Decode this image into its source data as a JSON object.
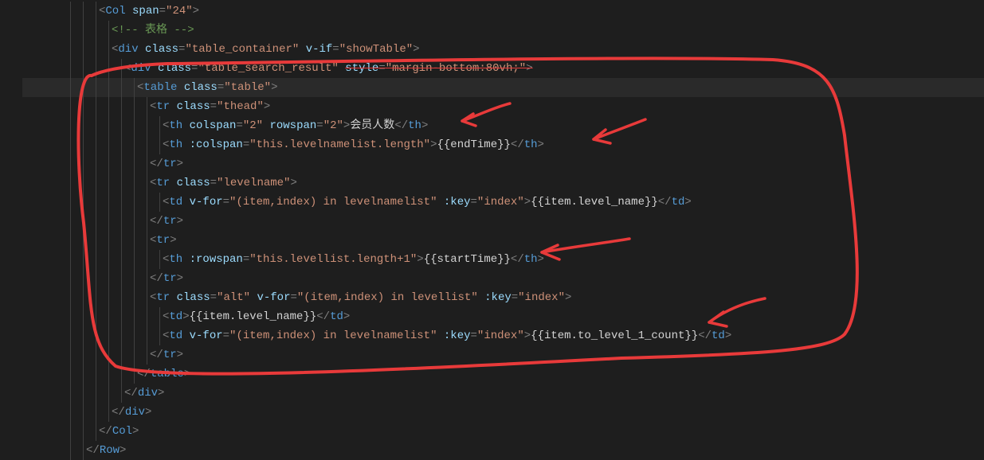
{
  "lines": {
    "l1": {
      "indent": 3,
      "tokens": [
        [
          "p-gray",
          "<"
        ],
        [
          "p-tag",
          "Col"
        ],
        [
          "p-txn",
          " "
        ],
        [
          "p-attr",
          "span"
        ],
        [
          "p-gray",
          "="
        ],
        [
          "p-str",
          "\"24\""
        ],
        [
          "p-gray",
          ">"
        ]
      ]
    },
    "l2": {
      "indent": 4,
      "tokens": [
        [
          "p-comm",
          "<!-- 表格 -->"
        ]
      ]
    },
    "l3": {
      "indent": 4,
      "tokens": [
        [
          "p-gray",
          "<"
        ],
        [
          "p-tag",
          "div"
        ],
        [
          "p-txn",
          " "
        ],
        [
          "p-attr",
          "class"
        ],
        [
          "p-gray",
          "="
        ],
        [
          "p-str",
          "\"table_container\""
        ],
        [
          "p-txn",
          " "
        ],
        [
          "p-attr",
          "v-if"
        ],
        [
          "p-gray",
          "="
        ],
        [
          "p-str",
          "\"showTable\""
        ],
        [
          "p-gray",
          ">"
        ]
      ]
    },
    "l4": {
      "indent": 5,
      "strike": true,
      "tokens": [
        [
          "p-gray",
          "<"
        ],
        [
          "p-tag",
          "div"
        ],
        [
          "p-txn",
          " "
        ],
        [
          "p-attr",
          "class"
        ],
        [
          "p-gray",
          "="
        ],
        [
          "p-str",
          "\"table_search_result\""
        ],
        [
          "p-txn",
          " "
        ],
        [
          "p-attr",
          "style"
        ],
        [
          "p-gray",
          "="
        ],
        [
          "p-str",
          "\"margin-bottom:80vh;\""
        ],
        [
          "p-gray",
          ">"
        ]
      ]
    },
    "l5": {
      "indent": 6,
      "hl": true,
      "tokens": [
        [
          "p-gray",
          "<"
        ],
        [
          "p-tag",
          "table"
        ],
        [
          "p-txn",
          " "
        ],
        [
          "p-attr",
          "class"
        ],
        [
          "p-gray",
          "="
        ],
        [
          "p-str",
          "\"table\""
        ],
        [
          "p-gray",
          ">"
        ]
      ]
    },
    "l6": {
      "indent": 7,
      "tokens": [
        [
          "p-gray",
          "<"
        ],
        [
          "p-tag",
          "tr"
        ],
        [
          "p-txn",
          " "
        ],
        [
          "p-attr",
          "class"
        ],
        [
          "p-gray",
          "="
        ],
        [
          "p-str",
          "\"thead\""
        ],
        [
          "p-gray",
          ">"
        ]
      ]
    },
    "l7": {
      "indent": 8,
      "tokens": [
        [
          "p-gray",
          "<"
        ],
        [
          "p-tag",
          "th"
        ],
        [
          "p-txn",
          " "
        ],
        [
          "p-attr",
          "colspan"
        ],
        [
          "p-gray",
          "="
        ],
        [
          "p-str",
          "\"2\""
        ],
        [
          "p-txn",
          " "
        ],
        [
          "p-attr",
          "rowspan"
        ],
        [
          "p-gray",
          "="
        ],
        [
          "p-str",
          "\"2\""
        ],
        [
          "p-gray",
          ">"
        ],
        [
          "p-txn",
          "会员人数"
        ],
        [
          "p-gray",
          "</"
        ],
        [
          "p-tag",
          "th"
        ],
        [
          "p-gray",
          ">"
        ]
      ]
    },
    "l8": {
      "indent": 8,
      "tokens": [
        [
          "p-gray",
          "<"
        ],
        [
          "p-tag",
          "th"
        ],
        [
          "p-txn",
          " "
        ],
        [
          "p-attr",
          ":colspan"
        ],
        [
          "p-gray",
          "="
        ],
        [
          "p-str",
          "\"this.levelnamelist.length\""
        ],
        [
          "p-gray",
          ">"
        ],
        [
          "p-txn",
          "{{endTime}}"
        ],
        [
          "p-gray",
          "</"
        ],
        [
          "p-tag",
          "th"
        ],
        [
          "p-gray",
          ">"
        ]
      ]
    },
    "l9": {
      "indent": 7,
      "tokens": [
        [
          "p-gray",
          "</"
        ],
        [
          "p-tag",
          "tr"
        ],
        [
          "p-gray",
          ">"
        ]
      ]
    },
    "l10": {
      "indent": 7,
      "tokens": [
        [
          "p-gray",
          "<"
        ],
        [
          "p-tag",
          "tr"
        ],
        [
          "p-txn",
          " "
        ],
        [
          "p-attr",
          "class"
        ],
        [
          "p-gray",
          "="
        ],
        [
          "p-str",
          "\"levelname\""
        ],
        [
          "p-gray",
          ">"
        ]
      ]
    },
    "l11": {
      "indent": 8,
      "tokens": [
        [
          "p-gray",
          "<"
        ],
        [
          "p-tag",
          "td"
        ],
        [
          "p-txn",
          " "
        ],
        [
          "p-attr",
          "v-for"
        ],
        [
          "p-gray",
          "="
        ],
        [
          "p-str",
          "\"(item,index) in levelnamelist\""
        ],
        [
          "p-txn",
          " "
        ],
        [
          "p-attr",
          ":key"
        ],
        [
          "p-gray",
          "="
        ],
        [
          "p-str",
          "\"index\""
        ],
        [
          "p-gray",
          ">"
        ],
        [
          "p-txn",
          "{{item.level_name}}"
        ],
        [
          "p-gray",
          "</"
        ],
        [
          "p-tag",
          "td"
        ],
        [
          "p-gray",
          ">"
        ]
      ]
    },
    "l12": {
      "indent": 7,
      "tokens": [
        [
          "p-gray",
          "</"
        ],
        [
          "p-tag",
          "tr"
        ],
        [
          "p-gray",
          ">"
        ]
      ]
    },
    "l13": {
      "indent": 7,
      "tokens": [
        [
          "p-gray",
          "<"
        ],
        [
          "p-tag",
          "tr"
        ],
        [
          "p-gray",
          ">"
        ]
      ]
    },
    "l14": {
      "indent": 8,
      "tokens": [
        [
          "p-gray",
          "<"
        ],
        [
          "p-tag",
          "th"
        ],
        [
          "p-txn",
          " "
        ],
        [
          "p-attr",
          ":rowspan"
        ],
        [
          "p-gray",
          "="
        ],
        [
          "p-str",
          "\"this.levellist.length+1\""
        ],
        [
          "p-gray",
          ">"
        ],
        [
          "p-txn",
          "{{startTime}}"
        ],
        [
          "p-gray",
          "</"
        ],
        [
          "p-tag",
          "th"
        ],
        [
          "p-gray",
          ">"
        ]
      ]
    },
    "l15": {
      "indent": 7,
      "tokens": [
        [
          "p-gray",
          "</"
        ],
        [
          "p-tag",
          "tr"
        ],
        [
          "p-gray",
          ">"
        ]
      ]
    },
    "l16": {
      "indent": 7,
      "tokens": [
        [
          "p-gray",
          "<"
        ],
        [
          "p-tag",
          "tr"
        ],
        [
          "p-txn",
          " "
        ],
        [
          "p-attr",
          "class"
        ],
        [
          "p-gray",
          "="
        ],
        [
          "p-str",
          "\"alt\""
        ],
        [
          "p-txn",
          " "
        ],
        [
          "p-attr",
          "v-for"
        ],
        [
          "p-gray",
          "="
        ],
        [
          "p-str",
          "\"(item,index) in levellist\""
        ],
        [
          "p-txn",
          " "
        ],
        [
          "p-attr",
          ":key"
        ],
        [
          "p-gray",
          "="
        ],
        [
          "p-str",
          "\"index\""
        ],
        [
          "p-gray",
          ">"
        ]
      ]
    },
    "l17": {
      "indent": 8,
      "tokens": [
        [
          "p-gray",
          "<"
        ],
        [
          "p-tag",
          "td"
        ],
        [
          "p-gray",
          ">"
        ],
        [
          "p-txn",
          "{{item.level_name}}"
        ],
        [
          "p-gray",
          "</"
        ],
        [
          "p-tag",
          "td"
        ],
        [
          "p-gray",
          ">"
        ]
      ]
    },
    "l18": {
      "indent": 8,
      "tokens": [
        [
          "p-gray",
          "<"
        ],
        [
          "p-tag",
          "td"
        ],
        [
          "p-txn",
          " "
        ],
        [
          "p-attr",
          "v-for"
        ],
        [
          "p-gray",
          "="
        ],
        [
          "p-str",
          "\"(item,index) in levelnamelist\""
        ],
        [
          "p-txn",
          " "
        ],
        [
          "p-attr",
          ":key"
        ],
        [
          "p-gray",
          "="
        ],
        [
          "p-str",
          "\"index\""
        ],
        [
          "p-gray",
          ">"
        ],
        [
          "p-txn",
          "{{item.to_level_1_count}}"
        ],
        [
          "p-gray",
          "</"
        ],
        [
          "p-tag",
          "td"
        ],
        [
          "p-gray",
          ">"
        ]
      ]
    },
    "l19": {
      "indent": 7,
      "tokens": [
        [
          "p-gray",
          "</"
        ],
        [
          "p-tag",
          "tr"
        ],
        [
          "p-gray",
          ">"
        ]
      ]
    },
    "l20": {
      "indent": 6,
      "tokens": [
        [
          "p-gray",
          "</"
        ],
        [
          "p-tag",
          "table"
        ],
        [
          "p-gray",
          ">"
        ]
      ]
    },
    "l21": {
      "indent": 5,
      "tokens": [
        [
          "p-gray",
          "</"
        ],
        [
          "p-tag",
          "div"
        ],
        [
          "p-gray",
          ">"
        ]
      ]
    },
    "l22": {
      "indent": 4,
      "tokens": [
        [
          "p-gray",
          "</"
        ],
        [
          "p-tag",
          "div"
        ],
        [
          "p-gray",
          ">"
        ]
      ]
    },
    "l23": {
      "indent": 3,
      "tokens": [
        [
          "p-gray",
          "</"
        ],
        [
          "p-tag",
          "Col"
        ],
        [
          "p-gray",
          ">"
        ]
      ]
    },
    "l24": {
      "indent": 2,
      "tokens": [
        [
          "p-gray",
          "</"
        ],
        [
          "p-tag",
          "Row"
        ],
        [
          "p-gray",
          ">"
        ]
      ]
    }
  },
  "colors": {
    "annotation": "#e83a3a"
  }
}
